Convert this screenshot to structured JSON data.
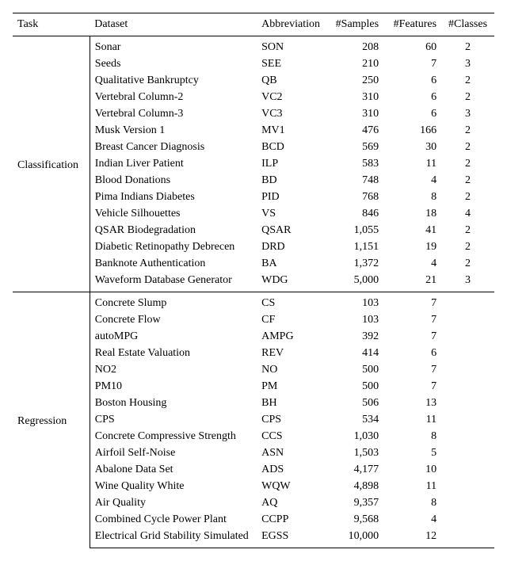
{
  "headers": {
    "task": "Task",
    "dataset": "Dataset",
    "abbr": "Abbreviation",
    "samples": "#Samples",
    "features": "#Features",
    "classes": "#Classes"
  },
  "groups": [
    {
      "task": "Classification",
      "rows": [
        {
          "dataset": "Sonar",
          "abbr": "SON",
          "samples": "208",
          "features": "60",
          "classes": "2"
        },
        {
          "dataset": "Seeds",
          "abbr": "SEE",
          "samples": "210",
          "features": "7",
          "classes": "3"
        },
        {
          "dataset": "Qualitative Bankruptcy",
          "abbr": "QB",
          "samples": "250",
          "features": "6",
          "classes": "2"
        },
        {
          "dataset": "Vertebral Column-2",
          "abbr": "VC2",
          "samples": "310",
          "features": "6",
          "classes": "2"
        },
        {
          "dataset": "Vertebral Column-3",
          "abbr": "VC3",
          "samples": "310",
          "features": "6",
          "classes": "3"
        },
        {
          "dataset": "Musk Version 1",
          "abbr": "MV1",
          "samples": "476",
          "features": "166",
          "classes": "2"
        },
        {
          "dataset": "Breast Cancer Diagnosis",
          "abbr": "BCD",
          "samples": "569",
          "features": "30",
          "classes": "2"
        },
        {
          "dataset": "Indian Liver Patient",
          "abbr": "ILP",
          "samples": "583",
          "features": "11",
          "classes": "2"
        },
        {
          "dataset": "Blood Donations",
          "abbr": "BD",
          "samples": "748",
          "features": "4",
          "classes": "2"
        },
        {
          "dataset": "Pima Indians Diabetes",
          "abbr": "PID",
          "samples": "768",
          "features": "8",
          "classes": "2"
        },
        {
          "dataset": "Vehicle Silhouettes",
          "abbr": "VS",
          "samples": "846",
          "features": "18",
          "classes": "4"
        },
        {
          "dataset": "QSAR Biodegradation",
          "abbr": "QSAR",
          "samples": "1,055",
          "features": "41",
          "classes": "2"
        },
        {
          "dataset": "Diabetic Retinopathy Debrecen",
          "abbr": "DRD",
          "samples": "1,151",
          "features": "19",
          "classes": "2"
        },
        {
          "dataset": "Banknote Authentication",
          "abbr": "BA",
          "samples": "1,372",
          "features": "4",
          "classes": "2"
        },
        {
          "dataset": "Waveform Database Generator",
          "abbr": "WDG",
          "samples": "5,000",
          "features": "21",
          "classes": "3"
        }
      ]
    },
    {
      "task": "Regression",
      "rows": [
        {
          "dataset": "Concrete Slump",
          "abbr": "CS",
          "samples": "103",
          "features": "7",
          "classes": ""
        },
        {
          "dataset": "Concrete Flow",
          "abbr": "CF",
          "samples": "103",
          "features": "7",
          "classes": ""
        },
        {
          "dataset": "autoMPG",
          "abbr": "AMPG",
          "samples": "392",
          "features": "7",
          "classes": ""
        },
        {
          "dataset": "Real Estate Valuation",
          "abbr": "REV",
          "samples": "414",
          "features": "6",
          "classes": ""
        },
        {
          "dataset": "NO2",
          "abbr": "NO",
          "samples": "500",
          "features": "7",
          "classes": ""
        },
        {
          "dataset": "PM10",
          "abbr": "PM",
          "samples": "500",
          "features": "7",
          "classes": ""
        },
        {
          "dataset": "Boston Housing",
          "abbr": "BH",
          "samples": "506",
          "features": "13",
          "classes": ""
        },
        {
          "dataset": "CPS",
          "abbr": "CPS",
          "samples": "534",
          "features": "11",
          "classes": ""
        },
        {
          "dataset": "Concrete Compressive Strength",
          "abbr": "CCS",
          "samples": "1,030",
          "features": "8",
          "classes": ""
        },
        {
          "dataset": "Airfoil Self-Noise",
          "abbr": "ASN",
          "samples": "1,503",
          "features": "5",
          "classes": ""
        },
        {
          "dataset": "Abalone Data Set",
          "abbr": "ADS",
          "samples": "4,177",
          "features": "10",
          "classes": ""
        },
        {
          "dataset": "Wine Quality White",
          "abbr": "WQW",
          "samples": "4,898",
          "features": "11",
          "classes": ""
        },
        {
          "dataset": "Air Quality",
          "abbr": "AQ",
          "samples": "9,357",
          "features": "8",
          "classes": ""
        },
        {
          "dataset": "Combined Cycle Power Plant",
          "abbr": "CCPP",
          "samples": "9,568",
          "features": "4",
          "classes": ""
        },
        {
          "dataset": "Electrical Grid Stability Simulated",
          "abbr": "EGSS",
          "samples": "10,000",
          "features": "12",
          "classes": ""
        }
      ]
    }
  ]
}
